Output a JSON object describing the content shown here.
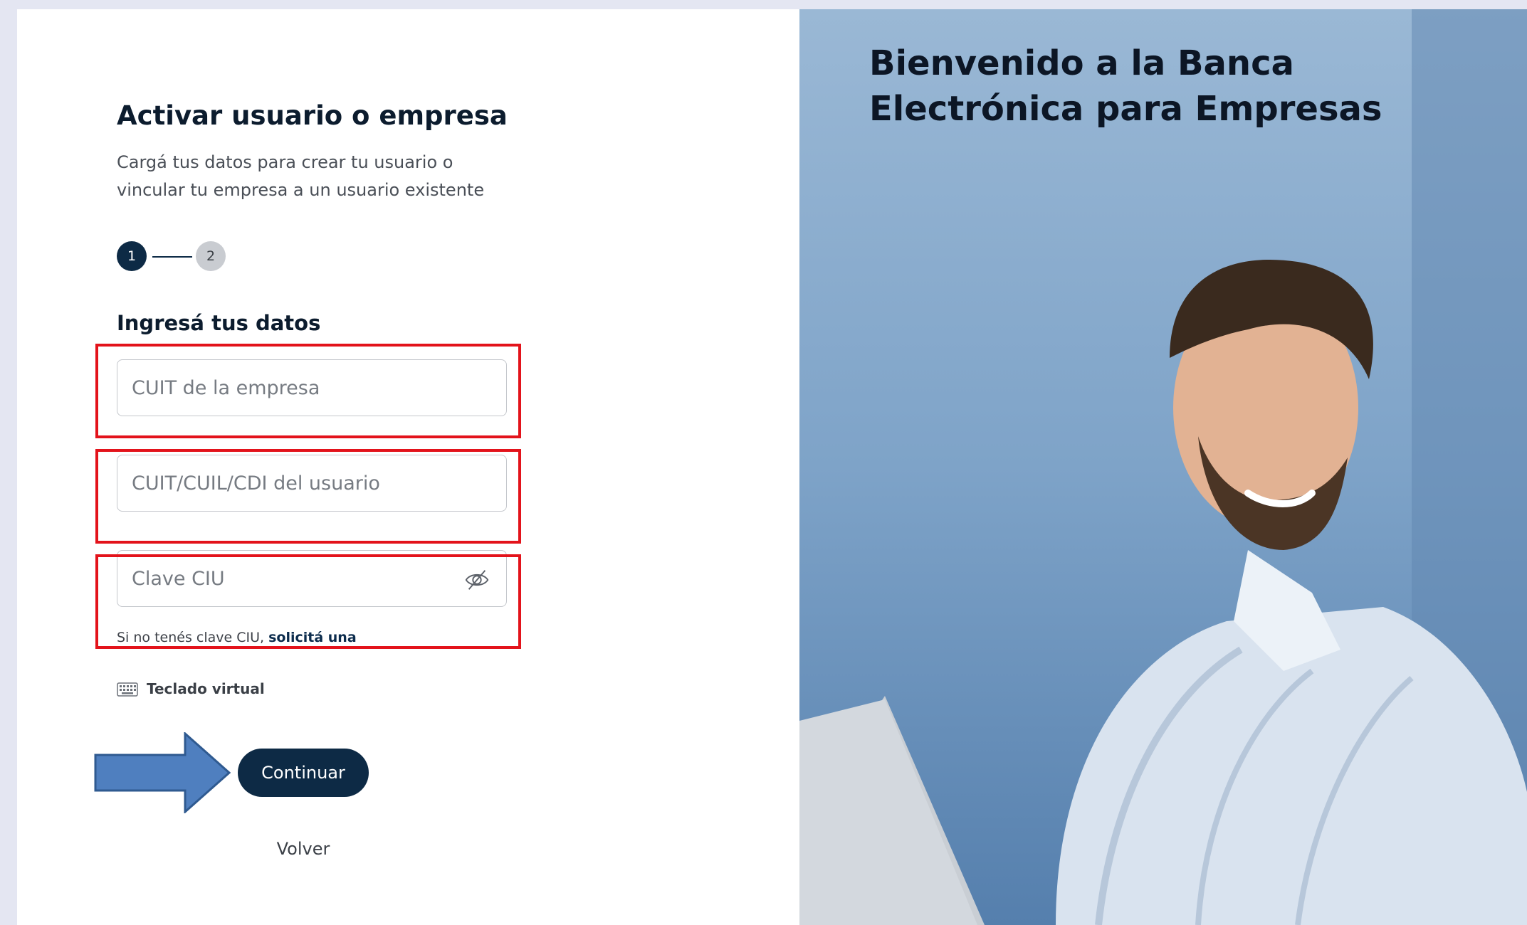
{
  "form": {
    "heading": "Activar usuario o empresa",
    "subheading": "Cargá tus datos para crear tu usuario o vincular tu empresa a un usuario existente",
    "steps": [
      "1",
      "2"
    ],
    "current_step": 1,
    "section_title": "Ingresá tus datos",
    "fields": {
      "cuit_empresa": {
        "value": "",
        "placeholder": "CUIT de la empresa"
      },
      "cuit_usuario": {
        "value": "",
        "placeholder": "CUIT/CUIL/CDI del usuario"
      },
      "clave_ciu": {
        "value": "",
        "placeholder": "Clave CIU",
        "toggle_icon": "eye-slash-icon"
      }
    },
    "helper_text": "Si no tenés clave CIU, ",
    "helper_link": "solicitá una",
    "virtual_keyboard": {
      "icon": "keyboard-icon",
      "label": "Teclado virtual"
    },
    "continue_label": "Continuar",
    "back_label": "Volver"
  },
  "hero": {
    "title": "Bienvenido a la Banca Electrónica para Empresas",
    "image": "smiling-man-at-laptop"
  },
  "annotations": {
    "highlight_color": "#e3131b",
    "arrow_color": "#4f7fbf",
    "arrow_target": "continue-button"
  },
  "colors": {
    "primary": "#0d2a45",
    "step_inactive": "#c9ccd1",
    "page_background": "#e4e6f2"
  }
}
